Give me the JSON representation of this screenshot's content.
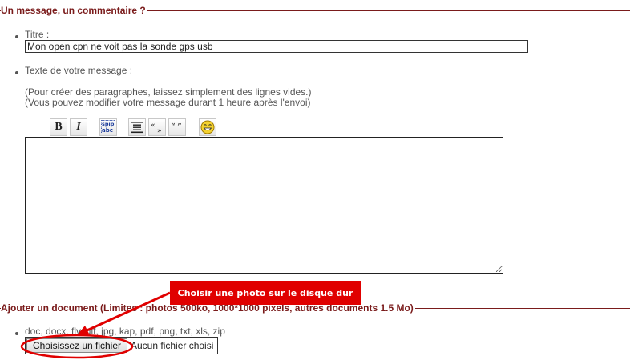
{
  "fieldset_message": {
    "legend": "Un message, un commentaire ?",
    "title_label": "Titre :",
    "title_value": "Mon open cpn ne voit pas la sonde gps usb",
    "message_label": "Texte de votre message :",
    "hint_line1": "(Pour créer des paragraphes, laissez simplement des lignes vides.)",
    "hint_line2": "(Vous pouvez modifier votre message durant 1 heure après l'envoi)",
    "toolbar": {
      "bold": "B",
      "italic": "I",
      "bold_icon": "bold-icon",
      "italic_icon": "italic-icon",
      "spip_icon": "spip-link-icon",
      "quote_block_icon": "quote-block-icon",
      "guillemets_icon": "french-quotes-icon",
      "quotes_icon": "english-quotes-icon",
      "smiley_icon": "smiley-icon"
    },
    "message_value": ""
  },
  "annotation": {
    "callout_text": "Choisir une photo sur le disque dur",
    "callout_color": "#e00000"
  },
  "fieldset_document": {
    "legend": "Ajouter un document (Limites : photos 500ko, 1000*1000 pixels, autres documents 1.5 Mo)",
    "formats": "doc, docx, flv, gif, jpg, kap, pdf, png, txt, xls, zip",
    "choose_button": "Choisissez un fichier",
    "no_file": "Aucun fichier choisi"
  },
  "colors": {
    "legend": "#7a1b1b",
    "text": "#555555",
    "annotation_red": "#e00000"
  }
}
